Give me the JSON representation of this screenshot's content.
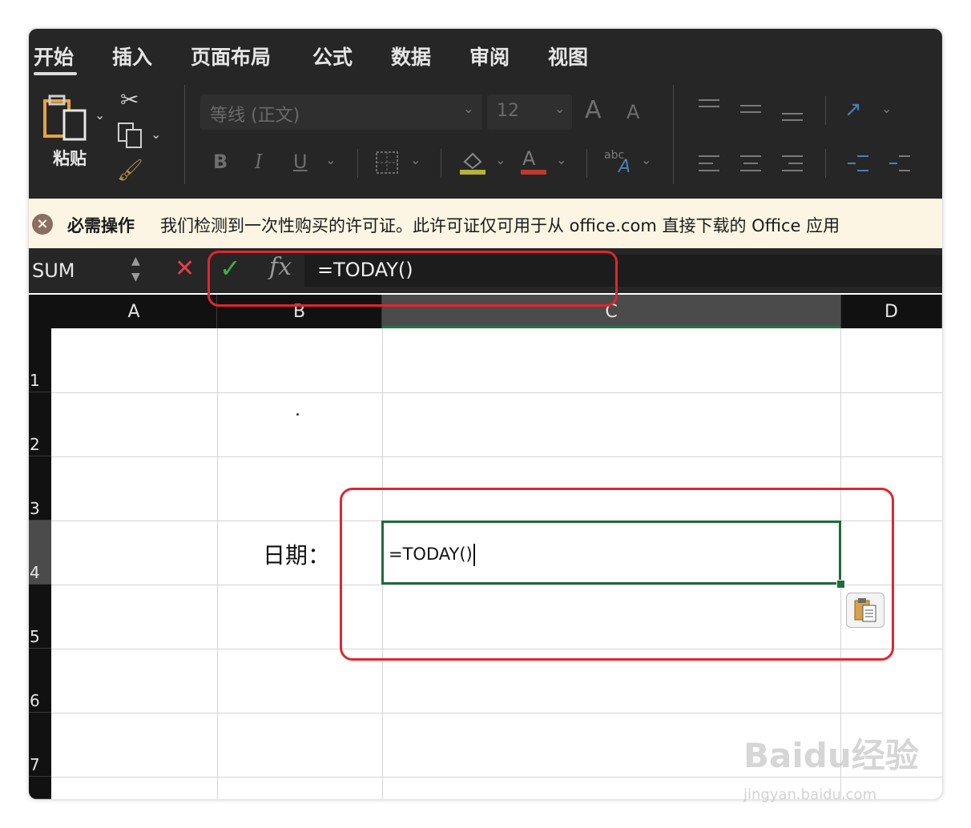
{
  "tabs": [
    "开始",
    "插入",
    "页面布局",
    "公式",
    "数据",
    "审阅",
    "视图"
  ],
  "ribbon": {
    "paste_label": "粘贴",
    "font_name": "等线 (正文)",
    "font_size": "12",
    "grow_font": "A",
    "shrink_font": "A",
    "bold": "B",
    "italic": "I",
    "underline": "U",
    "font_color_letter": "A",
    "abc_label": "abc",
    "fill_color": "#b8b33a",
    "font_color": "#c0392b"
  },
  "notice": {
    "title": "必需操作",
    "message": "我们检测到一次性购买的许可证。此许可证仅可用于从 office.com 直接下载的 Office 应用"
  },
  "formula_bar": {
    "name_box": "SUM",
    "fx_label": "fx",
    "formula": "=TODAY()"
  },
  "grid": {
    "columns": [
      "A",
      "B",
      "C",
      "D"
    ],
    "selected_column": "C",
    "rows": [
      "1",
      "2",
      "3",
      "4",
      "5",
      "6",
      "7"
    ],
    "selected_row": "4",
    "b4_label": "日期：",
    "c4_edit": "=TODAY()"
  },
  "watermark": {
    "brand": "Baidu经验",
    "url": "jingyan.baidu.com"
  }
}
